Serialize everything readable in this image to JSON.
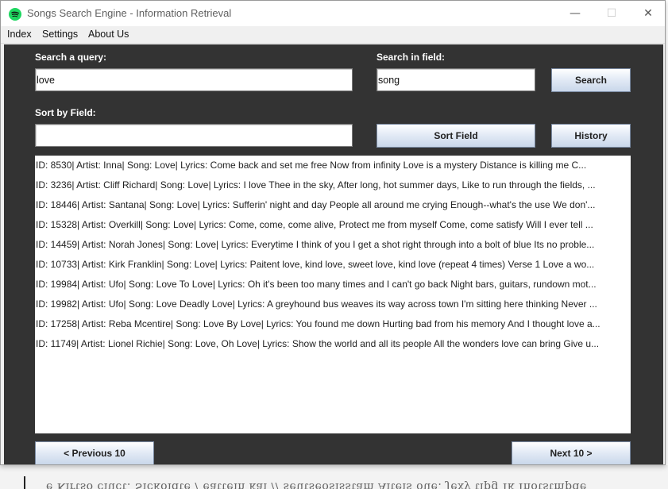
{
  "window": {
    "title": "Songs Search Engine - Information Retrieval",
    "controls": {
      "minimize": "—",
      "maximize": "☐",
      "close": "✕"
    },
    "icon": "spotify-logo-icon",
    "brand_color": "#1ed760"
  },
  "menu": {
    "items": [
      "Index",
      "Settings",
      "About Us"
    ]
  },
  "search": {
    "query_label": "Search a query:",
    "query_value": "love",
    "field_label": "Search in field:",
    "field_value": "song",
    "search_button": "Search"
  },
  "sort": {
    "label": "Sort by Field:",
    "value": "",
    "sort_button": "Sort Field",
    "history_button": "History"
  },
  "results": [
    "ID: 8530| Artist: Inna| Song: Love| Lyrics: Come back and set me free  Now from infinity  Love is a mystery  Distance is killing me    C...",
    "ID: 3236| Artist: Cliff Richard| Song: Love| Lyrics: I love Thee in the sky,  After long, hot summer days,  Like to run through the fields,  ...",
    "ID: 18446| Artist: Santana| Song: Love| Lyrics: Sufferin' night and day  People all around me crying  Enough--what's the use  We don'...",
    "ID: 15328| Artist: Overkill| Song: Love| Lyrics: Come, come, come alive,  Protect me from myself  Come, come satisfy  Will I ever tell  ...",
    "ID: 14459| Artist: Norah Jones| Song: Love| Lyrics: Everytime I think of you  I get a shot right through into a bolt of blue  Its no proble...",
    "ID: 10733| Artist: Kirk Franklin| Song: Love| Lyrics: Paitent love, kind love, sweet love, kind love (repeat 4 times)     Verse 1  Love a wo...",
    "ID: 19984| Artist: Ufo| Song: Love To Love| Lyrics: Oh it's been too many times and I can't go back  Night bars, guitars, rundown mot...",
    "ID: 19982| Artist: Ufo| Song: Love Deadly Love| Lyrics: A greyhound bus weaves its way across town  I'm sitting here thinking  Never ...",
    "ID: 17258| Artist: Reba Mcentire| Song: Love By Love| Lyrics: You found me down  Hurting bad from his memory  And I thought love a...",
    "ID: 11749| Artist: Lionel Richie| Song: Love, Oh Love| Lyrics: Show the world and all its people  All the wonders love can bring  Give u..."
  ],
  "pagination": {
    "previous": "< Previous 10",
    "next": "Next 10 >"
  }
}
